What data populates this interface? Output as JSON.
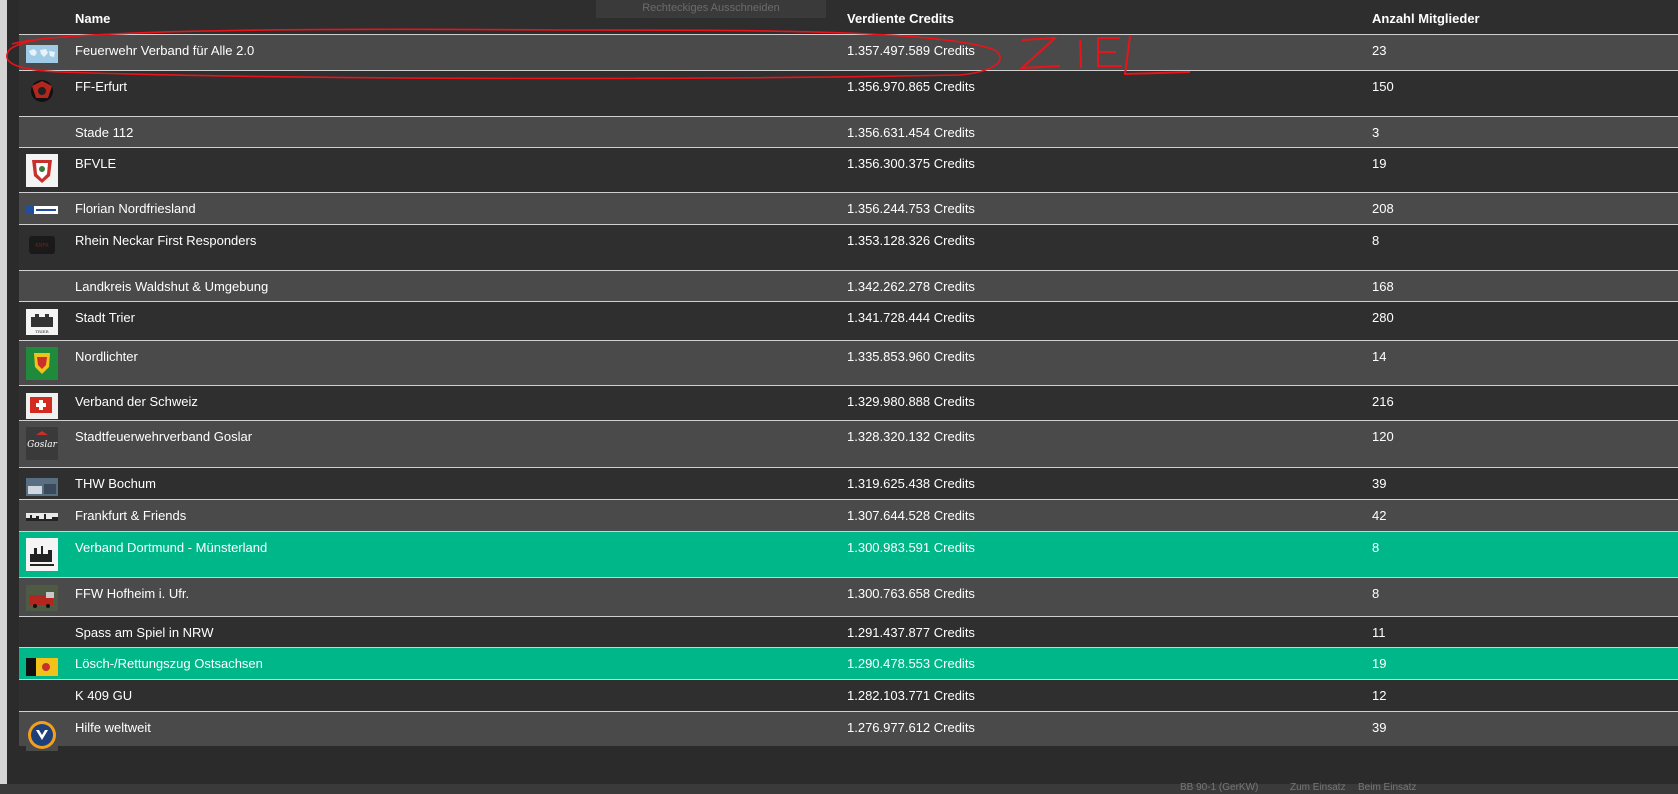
{
  "header": {
    "col_name": "Name",
    "col_credits": "Verdiente Credits",
    "col_members": "Anzahl Mitglieder",
    "ghost_label": "Rechteckiges Ausschneiden"
  },
  "rows": [
    {
      "name": "Feuerwehr Verband für Alle 2.0",
      "credits": "1.357.497.589 Credits",
      "members": "23",
      "logo": "world-map-logo"
    },
    {
      "name": "FF-Erfurt",
      "credits": "1.356.970.865 Credits",
      "members": "150",
      "logo": "fire-emblem-logo"
    },
    {
      "name": "Stade 112",
      "credits": "1.356.631.454 Credits",
      "members": "3",
      "logo": ""
    },
    {
      "name": "BFVLE",
      "credits": "1.356.300.375 Credits",
      "members": "19",
      "logo": "crest-logo"
    },
    {
      "name": "Florian Nordfriesland",
      "credits": "1.356.244.753 Credits",
      "members": "208",
      "logo": "banner-logo"
    },
    {
      "name": "Rhein Neckar First Responders",
      "credits": "1.353.128.326 Credits",
      "members": "8",
      "logo": "dark-emblem-logo"
    },
    {
      "name": "Landkreis Waldshut & Umgebung",
      "credits": "1.342.262.278 Credits",
      "members": "168",
      "logo": ""
    },
    {
      "name": "Stadt Trier",
      "credits": "1.341.728.444 Credits",
      "members": "280",
      "logo": "trier-logo"
    },
    {
      "name": "Nordlichter",
      "credits": "1.335.853.960 Credits",
      "members": "14",
      "logo": "green-crest-logo"
    },
    {
      "name": "Verband der Schweiz",
      "credits": "1.329.980.888 Credits",
      "members": "216",
      "logo": "swiss-flag-logo"
    },
    {
      "name": "Stadtfeuerwehrverband Goslar",
      "credits": "1.328.320.132 Credits",
      "members": "120",
      "logo": "goslar-logo"
    },
    {
      "name": "THW Bochum",
      "credits": "1.319.625.438 Credits",
      "members": "39",
      "logo": "thw-photo-logo"
    },
    {
      "name": "Frankfurt & Friends",
      "credits": "1.307.644.528 Credits",
      "members": "42",
      "logo": "skyline-logo"
    },
    {
      "name": "Verband Dortmund - Münsterland",
      "credits": "1.300.983.591 Credits",
      "members": "8",
      "logo": "dortmund-logo"
    },
    {
      "name": "FFW Hofheim i. Ufr.",
      "credits": "1.300.763.658 Credits",
      "members": "8",
      "logo": "firetruck-photo-logo"
    },
    {
      "name": "Spass am Spiel in NRW",
      "credits": "1.291.437.877 Credits",
      "members": "11",
      "logo": ""
    },
    {
      "name": "Lösch-/Rettungszug Ostsachsen",
      "credits": "1.290.478.553 Credits",
      "members": "19",
      "logo": "yellow-banner-logo"
    },
    {
      "name": "K 409 GU",
      "credits": "1.282.103.771 Credits",
      "members": "12",
      "logo": ""
    },
    {
      "name": "Hilfe weltweit",
      "credits": "1.276.977.612 Credits",
      "members": "39",
      "logo": "round-emblem-logo"
    }
  ],
  "annotation": {
    "text": "ZIEL",
    "color": "#e8141a"
  },
  "colors": {
    "row_light": "#4a4a4a",
    "row_dark": "#2f2f2f",
    "highlight": "#00b78a"
  },
  "bottom_bar": {
    "item1": "BB 90-1 (GerKW)",
    "item2": "Zum Einsatz",
    "item3": "Beim Einsatz"
  }
}
